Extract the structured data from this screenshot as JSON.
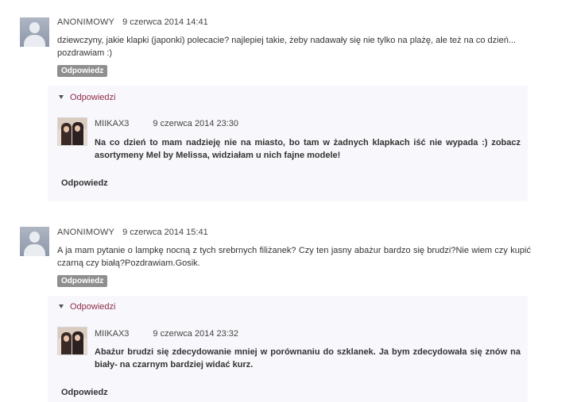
{
  "comments": [
    {
      "author": "ANONIMOWY",
      "date": "9 czerwca 2014 14:41",
      "text": "dziewczyny, jakie klapki (japonki) polecacie? najlepiej takie, żeby nadawały się nie tylko na plażę, ale też na co dzień... pozdrawiam :)",
      "reply_label": "Odpowiedz",
      "replies_toggle": "Odpowiedzi",
      "reply": {
        "author": "MIIKAX3",
        "date": "9 czerwca 2014 23:30",
        "text": "Na co dzień to mam nadzieję nie na miasto, bo tam w żadnych klapkach iść nie wypada :) zobacz asortymeny Mel by Melissa, widziałam u nich fajne modele!",
        "reply_label": "Odpowiedz"
      }
    },
    {
      "author": "ANONIMOWY",
      "date": "9 czerwca 2014 15:41",
      "text": "A ja mam pytanie o lampkę nocną z tych srebrnych filiżanek? Czy ten jasny abażur bardzo się brudzi?Nie wiem czy kupić czarną czy białą?Pozdrawiam.Gosik.",
      "reply_label": "Odpowiedz",
      "replies_toggle": "Odpowiedzi",
      "reply": {
        "author": "MIIKAX3",
        "date": "9 czerwca 2014 23:32",
        "text": "Abażur brudzi się zdecydowanie mniej w porównaniu do szklanek. Ja bym zdecydowała się znów na biały- na czarnym bardziej widać kurz.",
        "reply_label": "Odpowiedz"
      }
    }
  ],
  "colors": {
    "accent": "#8e2c48",
    "reply_button_bg": "#8f8f8f",
    "replies_bg": "#f8f7fb"
  },
  "icons": {
    "anon_avatar": "user-silhouette-icon",
    "toggle": "triangle-down-icon"
  }
}
